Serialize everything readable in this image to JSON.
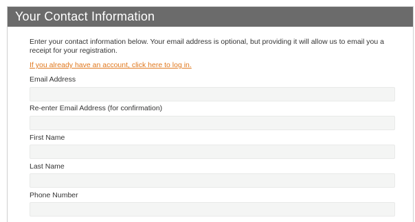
{
  "panel": {
    "title": "Your Contact Information"
  },
  "intro": {
    "text": "Enter your contact information below. Your email address is optional, but providing it will allow us to email you a receipt for your registration."
  },
  "login_link": {
    "text": "If you already have an account, click here to log in."
  },
  "fields": [
    {
      "label": "Email Address",
      "value": "",
      "placeholder": ""
    },
    {
      "label": "Re-enter Email Address (for confirmation)",
      "value": "",
      "placeholder": ""
    },
    {
      "label": "First Name",
      "value": "",
      "placeholder": ""
    },
    {
      "label": "Last Name",
      "value": "",
      "placeholder": ""
    },
    {
      "label": "Phone Number",
      "value": "",
      "placeholder": ""
    }
  ],
  "colors": {
    "header_bg": "#6b6b6b",
    "link": "#e0771c",
    "input_bg": "#f4f5f4"
  }
}
